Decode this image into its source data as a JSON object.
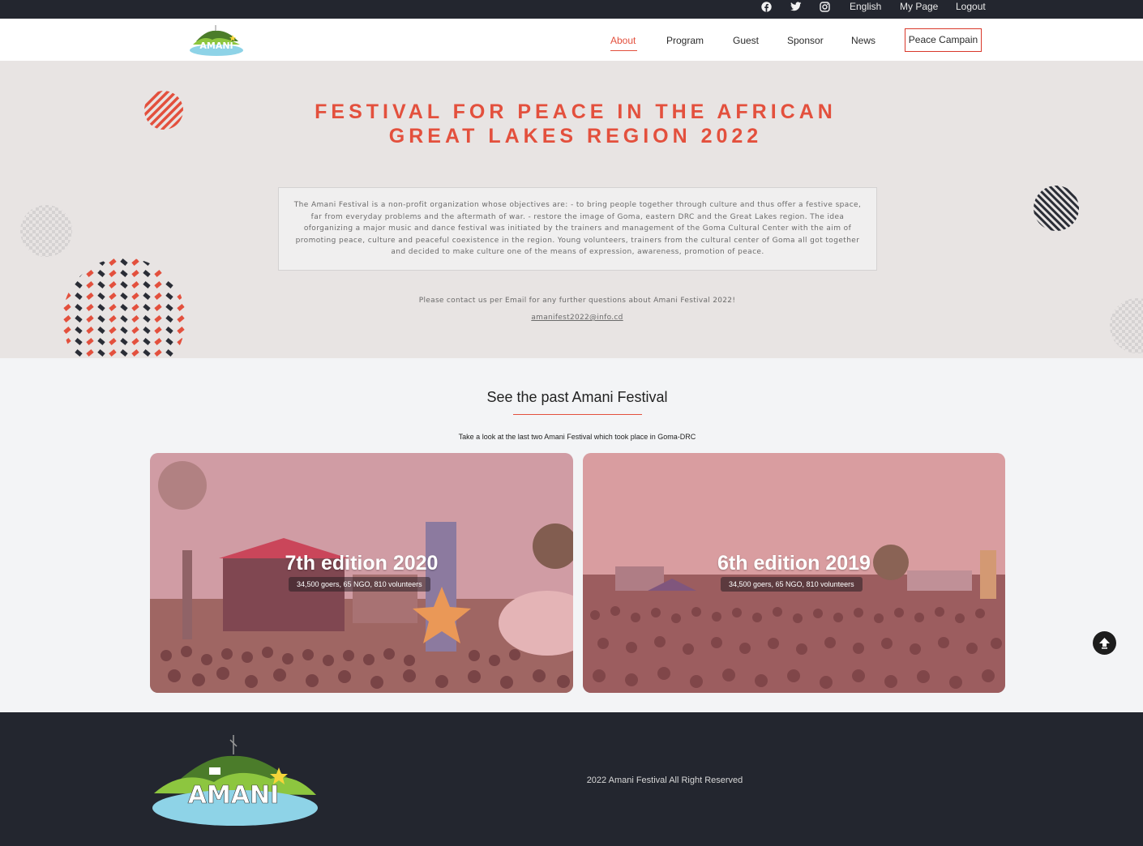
{
  "topbar": {
    "icons": [
      "facebook-icon",
      "twitter-icon",
      "instagram-icon"
    ],
    "language": "English",
    "my_page": "My Page",
    "logout": "Logout"
  },
  "logo": {
    "text": "AMANI"
  },
  "nav": {
    "items": [
      {
        "label": "About",
        "active": true
      },
      {
        "label": "Program"
      },
      {
        "label": "Guest"
      },
      {
        "label": "Sponsor"
      },
      {
        "label": "News"
      }
    ],
    "cta": "Peace Campain"
  },
  "hero": {
    "title_line1": "FESTIVAL FOR PEACE IN THE AFRICAN",
    "title_line2": "GREAT LAKES REGION 2022",
    "description": "The Amani Festival is a non-profit organization whose objectives are: - to bring people together through culture and thus offer a festive space, far from everyday problems and the aftermath of war. - restore the image of Goma, eastern DRC and the Great Lakes region. The idea oforganizing a major music and dance festival was initiated by the trainers and management of the Goma Cultural Center with the aim of promoting peace, culture and peaceful coexistence in the region. Young volunteers, trainers from the cultural center of Goma all got together and decided to make culture one of the means of expression, awareness, promotion of peace.",
    "contact": "Please contact us per Email for any further questions about Amani Festival 2022!",
    "email": "amanifest2022@info.cd"
  },
  "past": {
    "title": "See the past Amani Festival",
    "subtitle": "Take a look at the last two Amani Festival which took place in Goma-DRC",
    "cards": [
      {
        "title": "7th edition 2020",
        "stats": "34,500 goers, 65 NGO, 810 volunteers"
      },
      {
        "title": "6th edition 2019",
        "stats": "34,500 goers, 65 NGO, 810 volunteers"
      }
    ]
  },
  "footer": {
    "copyright": "2022 Amani Festival All Right Reserved"
  },
  "colors": {
    "accent": "#e3503d",
    "dark": "#23262f",
    "hero_bg": "#e8e4e3"
  }
}
